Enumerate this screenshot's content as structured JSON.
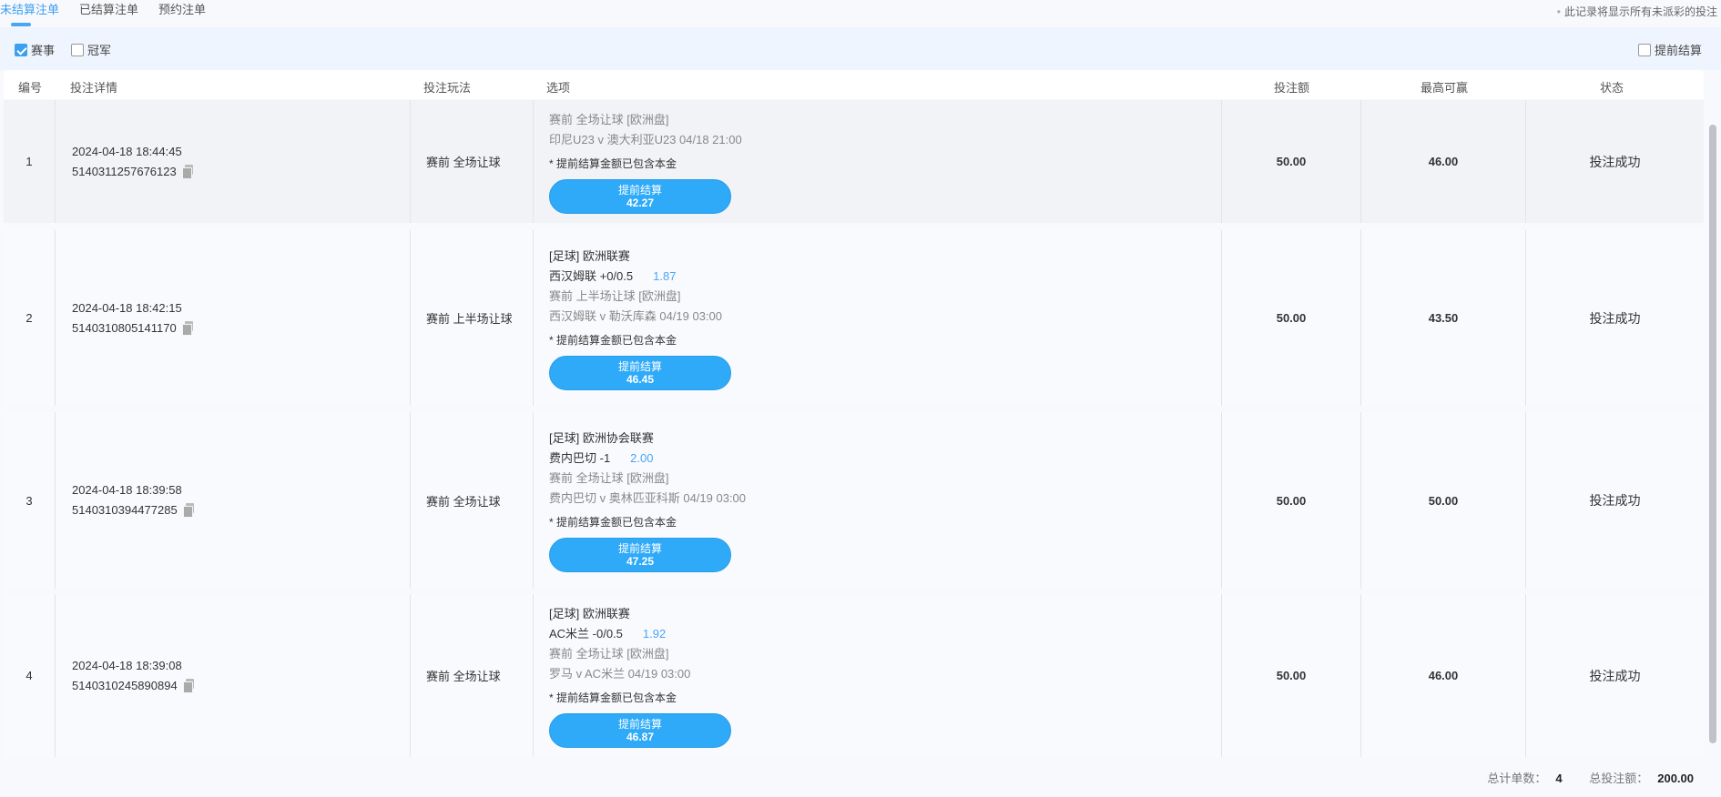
{
  "tabs": [
    "未结算注单",
    "已结算注单",
    "预约注单"
  ],
  "note": "此记录将显示所有未派彩的投注",
  "filters": {
    "event": "赛事",
    "champion": "冠军",
    "cashout": "提前结算"
  },
  "headers": {
    "num": "编号",
    "detail": "投注详情",
    "type": "投注玩法",
    "option": "选项",
    "stake": "投注额",
    "maxwin": "最高可赢",
    "status": "状态"
  },
  "rows": [
    {
      "num": "1",
      "time": "2024-04-18 18:44:45",
      "id": "5140311257676123",
      "type": "赛前  全场让球",
      "league": "",
      "pick": "",
      "odds": "",
      "market": "赛前 全场让球 [欧洲盘]",
      "match": "印尼U23 v 澳大利亚U23   04/18 21:00",
      "note": "* 提前结算金额已包含本金",
      "btn": "提前结算",
      "cashout": "42.27",
      "stake": "50.00",
      "maxwin": "46.00",
      "status": "投注成功"
    },
    {
      "num": "2",
      "time": "2024-04-18 18:42:15",
      "id": "5140310805141170",
      "type": "赛前  上半场让球",
      "league": "[足球] 欧洲联赛",
      "pick": "西汉姆联 +0/0.5",
      "odds": "1.87",
      "market": "赛前 上半场让球 [欧洲盘]",
      "match": "西汉姆联 v 勒沃库森   04/19 03:00",
      "note": "* 提前结算金额已包含本金",
      "btn": "提前结算",
      "cashout": "46.45",
      "stake": "50.00",
      "maxwin": "43.50",
      "status": "投注成功"
    },
    {
      "num": "3",
      "time": "2024-04-18 18:39:58",
      "id": "5140310394477285",
      "type": "赛前  全场让球",
      "league": "[足球] 欧洲协会联赛",
      "pick": "费内巴切 -1",
      "odds": "2.00",
      "market": "赛前 全场让球 [欧洲盘]",
      "match": "费内巴切 v 奥林匹亚科斯   04/19 03:00",
      "note": "* 提前结算金额已包含本金",
      "btn": "提前结算",
      "cashout": "47.25",
      "stake": "50.00",
      "maxwin": "50.00",
      "status": "投注成功"
    },
    {
      "num": "4",
      "time": "2024-04-18 18:39:08",
      "id": "5140310245890894",
      "type": "赛前  全场让球",
      "league": "[足球] 欧洲联赛",
      "pick": "AC米兰 -0/0.5",
      "odds": "1.92",
      "market": "赛前 全场让球 [欧洲盘]",
      "match": "罗马 v AC米兰   04/19 03:00",
      "note": "* 提前结算金额已包含本金",
      "btn": "提前结算",
      "cashout": "46.87",
      "stake": "50.00",
      "maxwin": "46.00",
      "status": "投注成功"
    }
  ],
  "footer": {
    "count_label": "总计单数：",
    "count": "4",
    "total_label": "总投注额：",
    "total": "200.00"
  },
  "colors": {
    "accent": "#2eaaf8",
    "tab_active": "#3d9ff0",
    "odds": "#4aa6f5"
  }
}
